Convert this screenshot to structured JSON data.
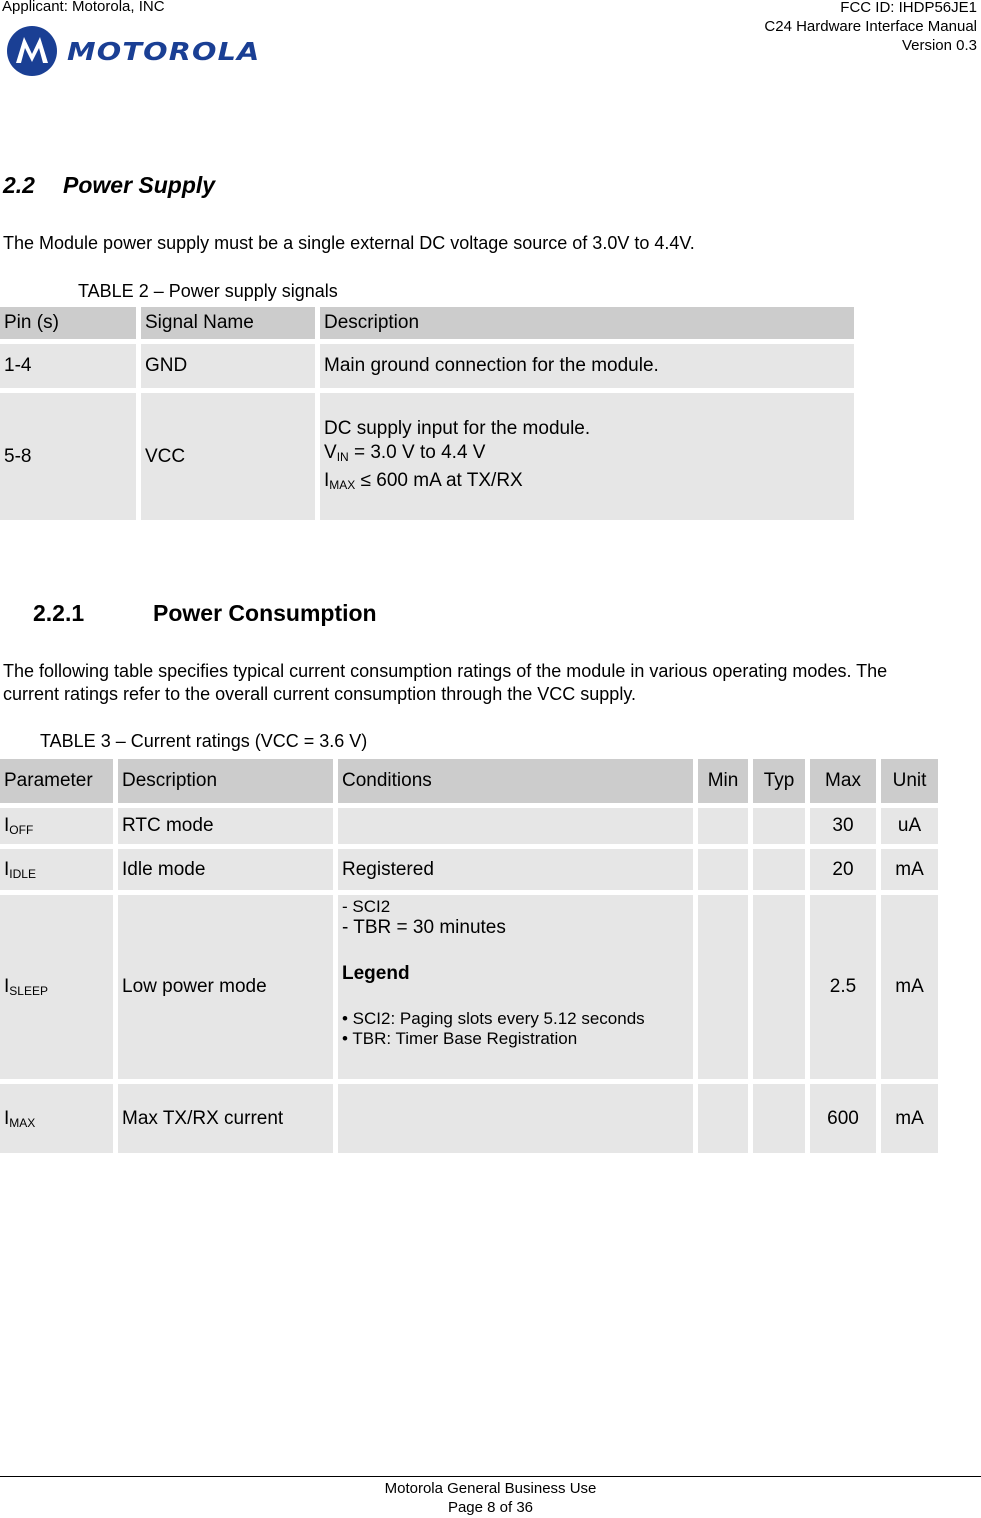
{
  "header": {
    "applicant": "Applicant: Motorola, INC",
    "fcc_id": "FCC ID: IHDP56JE1",
    "manual": "C24 Hardware Interface Manual",
    "version": "Version 0.3",
    "logo_text": "MOTOROLA",
    "brand_color": "#1a3f94"
  },
  "section": {
    "number": "2.2",
    "title": "Power Supply",
    "intro": "The Module power supply must be a single external DC voltage source of 3.0V to 4.4V."
  },
  "table2": {
    "caption": "TABLE 2 – Power supply signals",
    "headers": [
      "Pin (s)",
      "Signal Name",
      "Description"
    ],
    "rows": [
      {
        "pin": "1-4",
        "signal": "GND",
        "desc": "Main ground connection for the module."
      },
      {
        "pin": "5-8",
        "signal": "VCC",
        "desc_line1": "DC supply input for the module.",
        "vin_base": "V",
        "vin_sub": "IN",
        "vin_rest": " = 3.0 V to 4.4 V",
        "imax_base": "I",
        "imax_sub": "MAX",
        "imax_rest": " ≤ 600 mA at TX/RX"
      }
    ]
  },
  "subsection": {
    "number": "2.2.1",
    "title": "Power Consumption",
    "intro": "The following table specifies typical current consumption ratings of the module in various operating modes. The current ratings refer to the overall current consumption through the VCC supply."
  },
  "table3": {
    "caption": "TABLE 3 – Current ratings (VCC = 3.6 V)",
    "headers": [
      "Parameter",
      "Description",
      "Conditions",
      "Min",
      "Typ",
      "Max",
      "Unit"
    ],
    "rows": [
      {
        "param_base": "I",
        "param_sub": "OFF",
        "desc": "RTC mode",
        "cond": "",
        "min": "",
        "typ": "",
        "max": "30",
        "unit": "uA"
      },
      {
        "param_base": "I",
        "param_sub": "IDLE",
        "desc": "Idle mode",
        "cond": "Registered",
        "min": "",
        "typ": "",
        "max": "20",
        "unit": "mA"
      },
      {
        "param_base": "I",
        "param_sub": "SLEEP",
        "desc": "Low power mode",
        "cond_l1": "- SCI2",
        "cond_l2": "- TBR = 30 minutes",
        "cond_legend": "Legend",
        "cond_b1": "• SCI2: Paging slots every 5.12 seconds",
        "cond_b2": "• TBR: Timer Base Registration",
        "min": "",
        "typ": "",
        "max": "2.5",
        "unit": "mA"
      },
      {
        "param_base": "I",
        "param_sub": "MAX",
        "desc": "Max TX/RX current",
        "cond": "",
        "min": "",
        "typ": "",
        "max": "600",
        "unit": "mA"
      }
    ]
  },
  "footer": {
    "classification": "Motorola General Business Use",
    "page": "Page 8 of 36"
  }
}
